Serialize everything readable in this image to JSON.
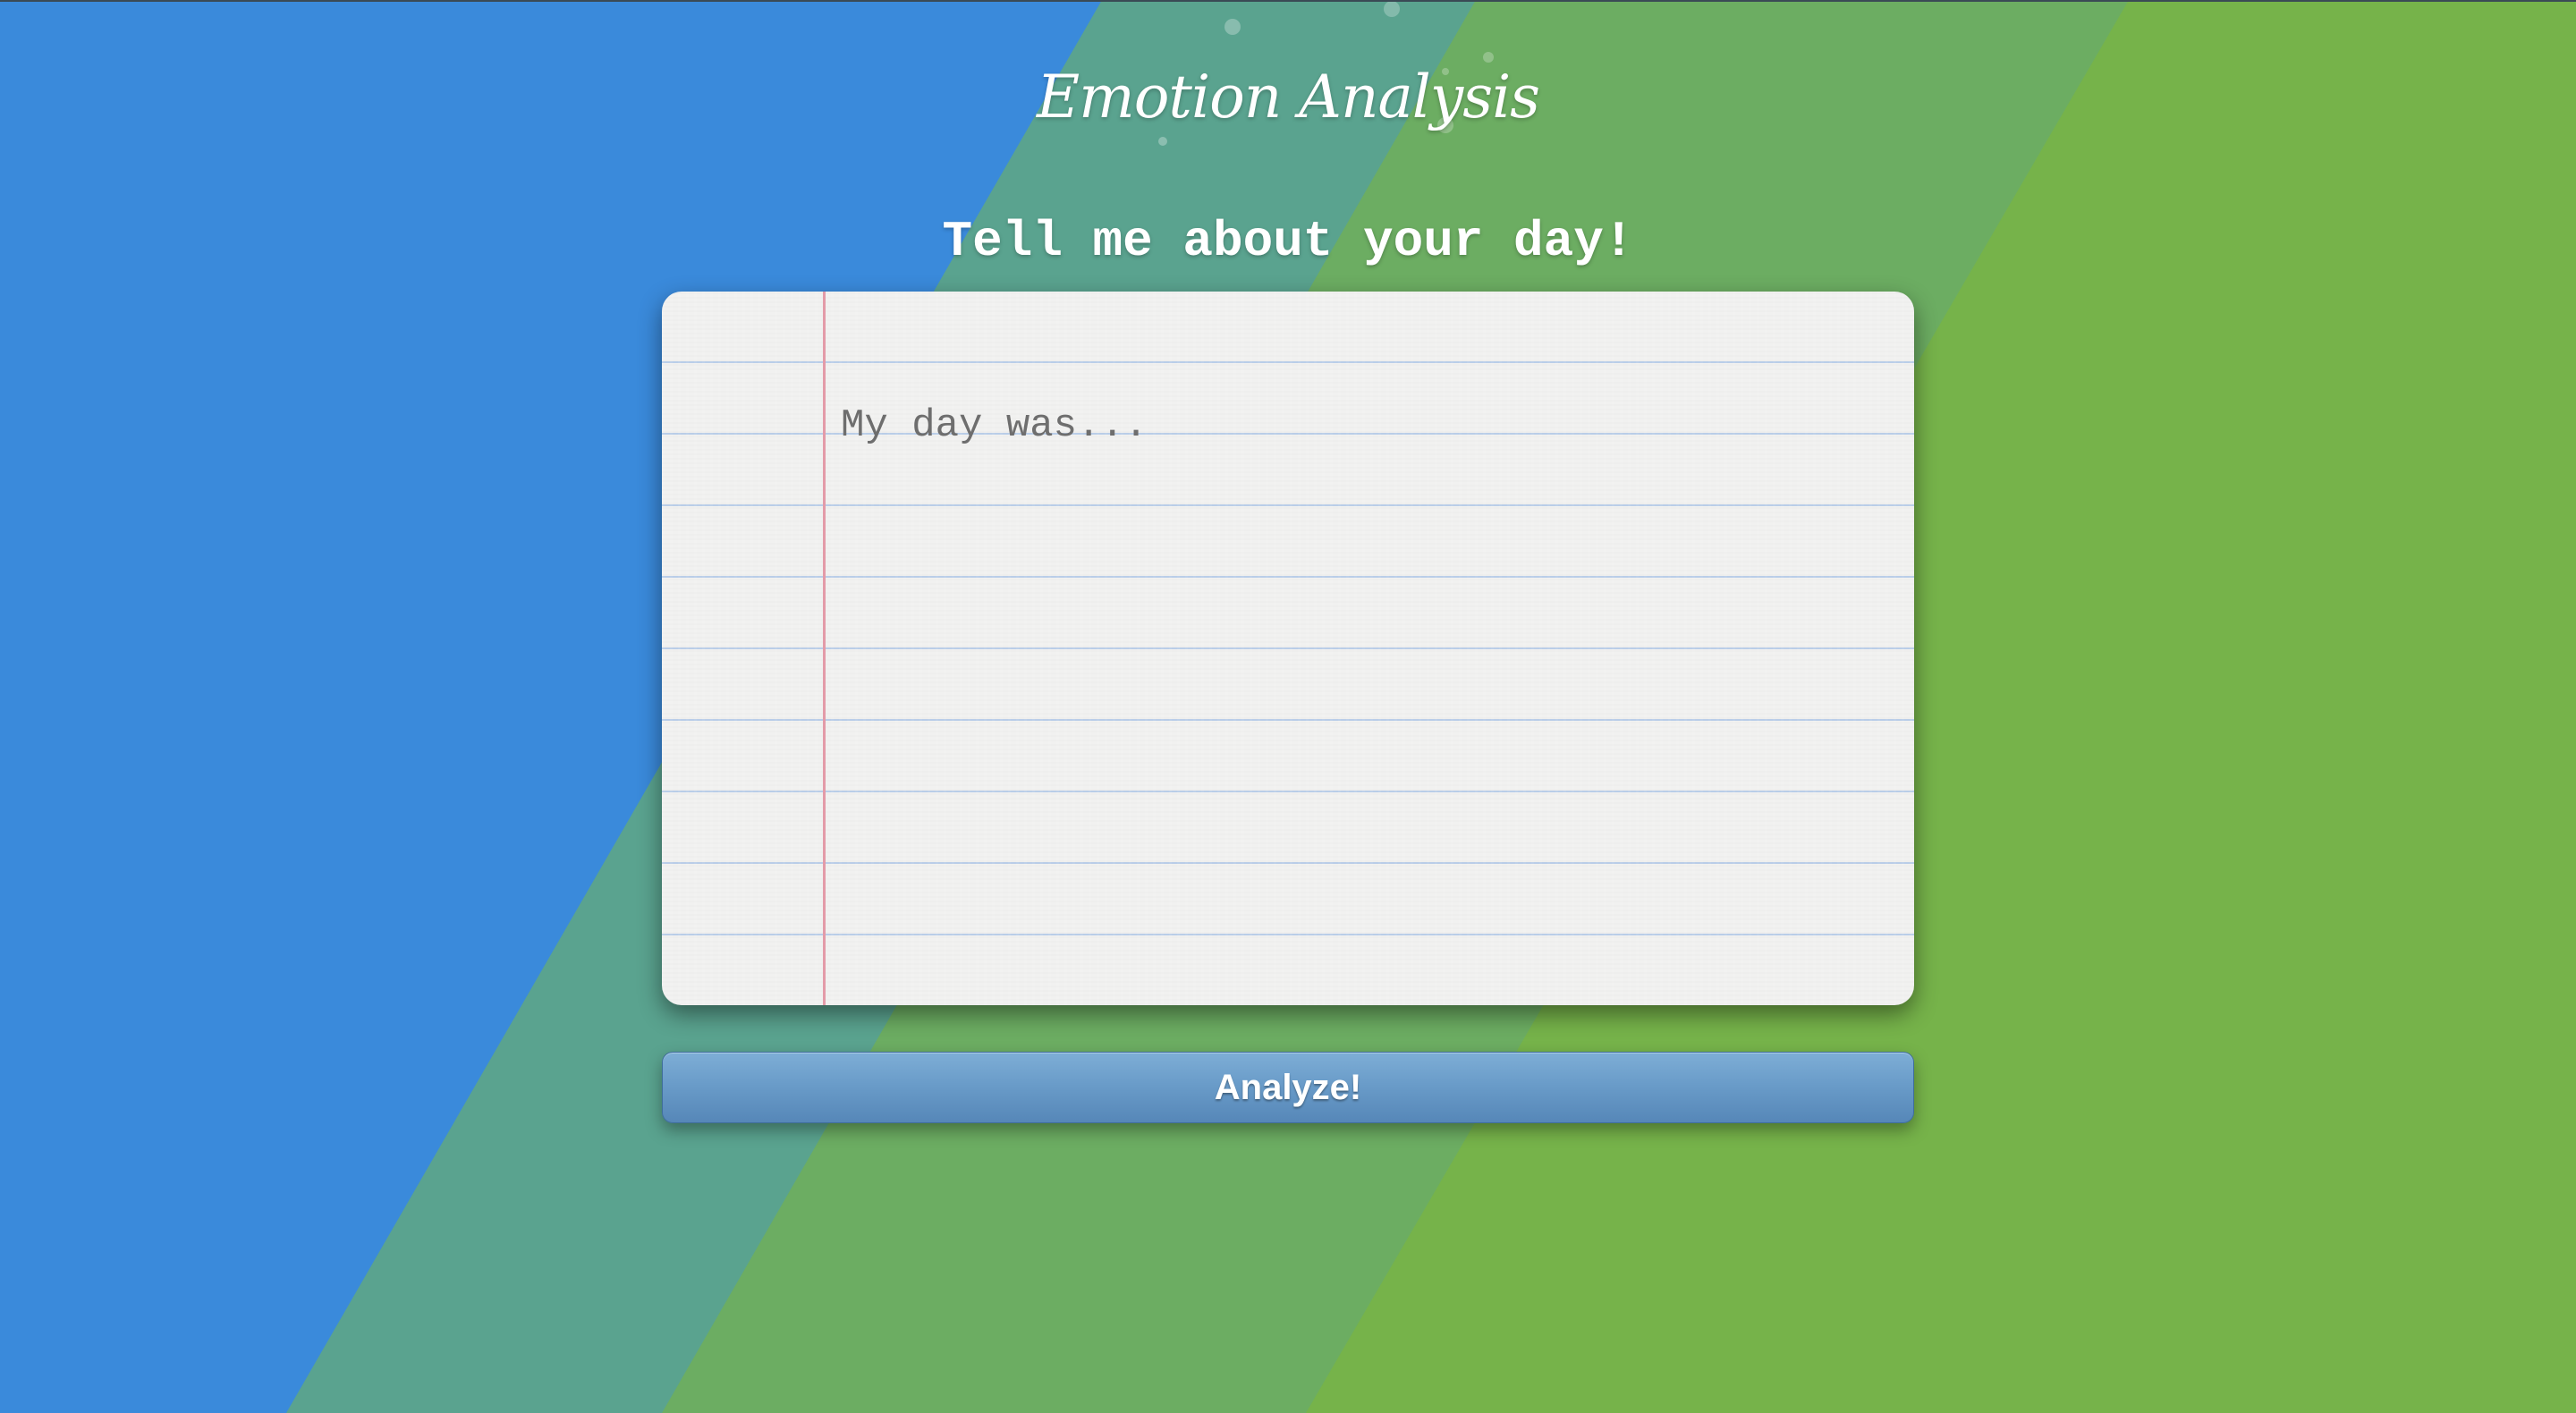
{
  "app": {
    "title": "Emotion Analysis",
    "prompt": "Tell me about your day!"
  },
  "journal": {
    "value": "",
    "placeholder": "My day was..."
  },
  "actions": {
    "analyze_label": "Analyze!"
  },
  "colors": {
    "blue_band": "#3a8adb",
    "teal_band": "#5aa38f",
    "mid_green_band": "#6cad62",
    "green_band": "#76b34a",
    "button_top": "#7eaed6",
    "button_bottom": "#5687b8",
    "paper": "#f1f1f0",
    "rule_line": "#b9cde8",
    "margin_line": "#e39ba8"
  }
}
